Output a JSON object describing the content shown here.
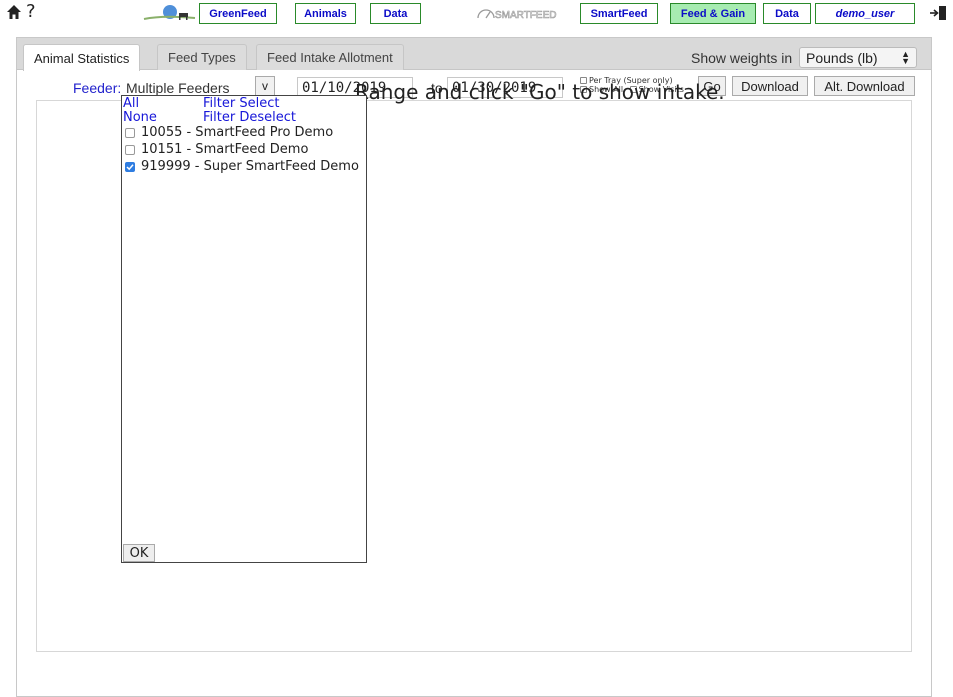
{
  "topnav": {
    "help": "?",
    "buttons": {
      "greenfeed": "GreenFeed",
      "animals_gf": "Animals",
      "data_gf": "Data",
      "smartfeed": "SmartFeed",
      "feed_gain": "Feed & Gain",
      "data_sf": "Data",
      "user": "demo_user"
    },
    "smartfeed_logo_text": "SMARTFEED",
    "colors": {
      "border": "#2a8a2a",
      "active_bg": "#a7ecb1",
      "link": "#0b0bc8"
    }
  },
  "tabs": {
    "animal_statistics": "Animal Statistics",
    "feed_types": "Feed Types",
    "feed_intake_allotment": "Feed Intake Allotment"
  },
  "weights": {
    "label": "Show weights in",
    "selected": "Pounds (lb)"
  },
  "filters": {
    "feeder_label": "Feeder:",
    "feeder_value": "Multiple Feeders",
    "feeder_toggle": "v",
    "date_from": "01/10/2019",
    "to_label": "to",
    "date_to": "01/30/2019",
    "per_tray": "Per Tray (Super only)",
    "show_all": "Show All",
    "show_visits": "Show Visits",
    "go": "Go",
    "download": "Download",
    "alt_download": "Alt. Download"
  },
  "message": "Range and click \"Go\" to show intake.",
  "dropdown": {
    "all": "All",
    "none": "None",
    "filter_select": "Filter Select",
    "filter_deselect": "Filter Deselect",
    "items": [
      {
        "label": "10055 - SmartFeed Pro Demo",
        "checked": false
      },
      {
        "label": "10151 - SmartFeed Demo",
        "checked": false
      },
      {
        "label": "919999 - Super SmartFeed Demo",
        "checked": true
      }
    ],
    "ok": "OK"
  }
}
